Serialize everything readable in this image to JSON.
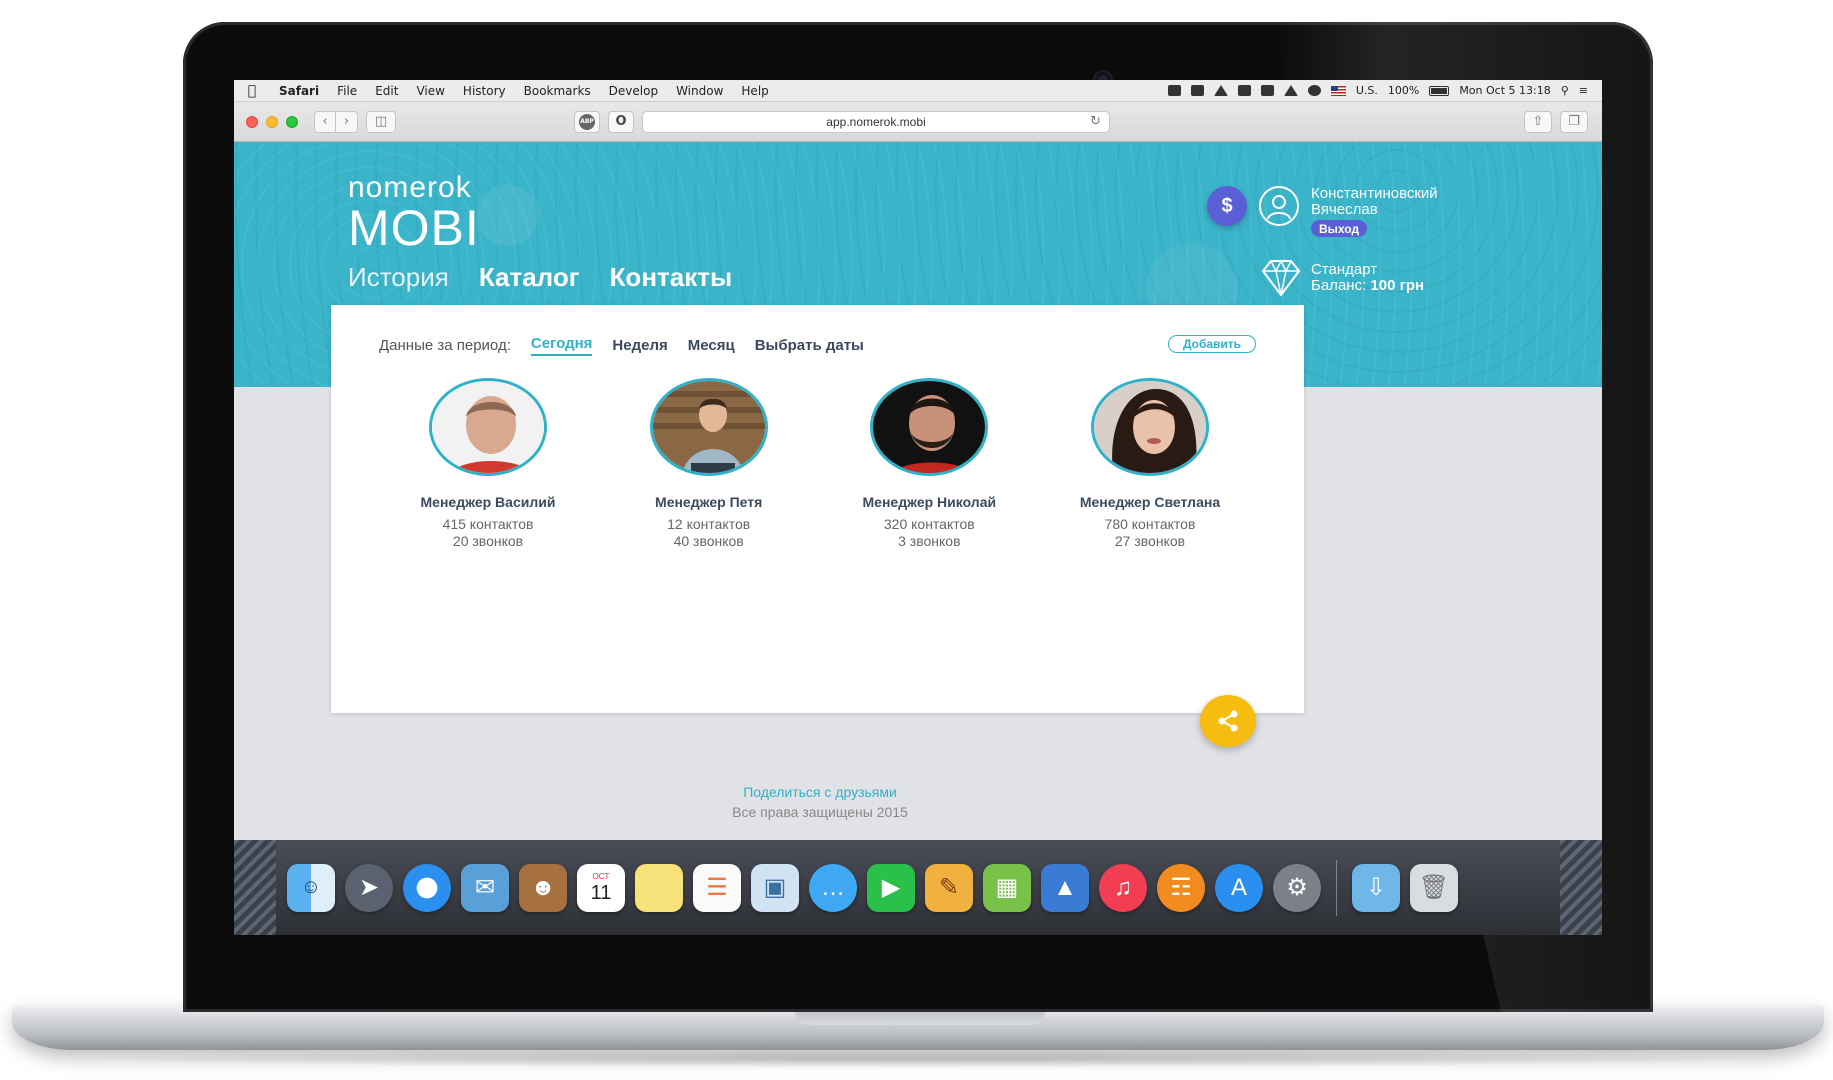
{
  "menubar": {
    "app": "Safari",
    "items": [
      "File",
      "Edit",
      "View",
      "History",
      "Bookmarks",
      "Develop",
      "Window",
      "Help"
    ],
    "input_source": "U.S.",
    "battery": "100%",
    "datetime": "Mon Oct 5  13:18"
  },
  "browser": {
    "url": "app.nomerok.mobi",
    "ext_badge": "ABP"
  },
  "site": {
    "logo_top": "nomerok",
    "logo_bottom": "MOBI",
    "nav": [
      "История",
      "Каталог",
      "Контакты"
    ]
  },
  "user": {
    "balance_icon": "$",
    "name_line1": "Константиновский",
    "name_line2": "Вячеслав",
    "logout": "Выход",
    "plan": "Стандарт",
    "balance_label": "Баланс:",
    "balance_value": "100 грн"
  },
  "filters": {
    "label": "Данные за период:",
    "tabs": [
      "Сегодня",
      "Неделя",
      "Месяц",
      "Выбрать даты"
    ],
    "active": "Сегодня",
    "add_button": "Добавить"
  },
  "managers": [
    {
      "name": "Менеджер Василий",
      "contacts": "415 контактов",
      "calls": "20 звонков"
    },
    {
      "name": "Менеджер Петя",
      "contacts": "12 контактов",
      "calls": "40 звонков"
    },
    {
      "name": "Менеджер Николай",
      "contacts": "320 контактов",
      "calls": "3 звонков"
    },
    {
      "name": "Менеджер Светлана",
      "contacts": "780 контактов",
      "calls": "27 звонков"
    }
  ],
  "footer": {
    "share": "Поделиться с друзьями",
    "copyright": "Все права защищены 2015"
  },
  "dock": {
    "calendar_month": "OCT",
    "calendar_day": "11"
  },
  "colors": {
    "brand": "#3ab4c9",
    "accent_purple": "#5b5fd6",
    "share_yellow": "#f6bc10"
  }
}
